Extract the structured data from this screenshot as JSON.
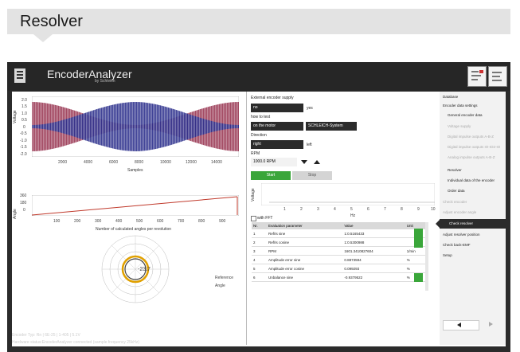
{
  "heading": {
    "title": "Resolver"
  },
  "app": {
    "title": "EncoderAnalyzer",
    "subtitle": "by Schleich",
    "toolbar_icons": [
      "report-icon",
      "export-icon"
    ]
  },
  "signal_chart": {
    "ylabel": "Voltage",
    "xlabel": "Samples",
    "y_ticks": [
      "2.0",
      "1.5",
      "1.0",
      "0.5",
      "0",
      "-0.5",
      "-1.0",
      "-1.5",
      "-2.0"
    ],
    "x_ticks": [
      "2000",
      "4000",
      "6000",
      "8000",
      "10000",
      "12000",
      "14000"
    ]
  },
  "angle_chart": {
    "ylabel": "Angle",
    "xlabel": "Number of calculated angles per revolution",
    "y_ticks": [
      "360",
      "180",
      "0"
    ],
    "x_ticks": [
      "100",
      "200",
      "300",
      "400",
      "500",
      "600",
      "700",
      "800",
      "900"
    ]
  },
  "polar": {
    "value": "-23.7",
    "legend": [
      "Reference",
      "Angle"
    ],
    "colors": [
      "#8a8a8a",
      "#e0a000"
    ]
  },
  "settings": {
    "supply_label": "External encoder supply",
    "supply_value": "no",
    "supply_unit": "yes",
    "test_label": "how to test",
    "test_value": "on the motor",
    "test_system": "SCHLEICH-System",
    "direction_label": "Direction",
    "direction_value": "right",
    "direction_alt": "left",
    "rpm_label": "RPM",
    "rpm_value": "1000.0 RPM",
    "start_label": "Start",
    "stop_label": "Stop"
  },
  "fft_chart": {
    "ylabel": "Voltage",
    "xlabel": "Hz",
    "x_ticks": [
      "1",
      "2",
      "3",
      "4",
      "5",
      "6",
      "7",
      "8",
      "9",
      "10"
    ],
    "checkbox_label": "with FFT"
  },
  "eval_table": {
    "headers": [
      "Nr.",
      "Evaluation parameter",
      "Value",
      "Unit"
    ],
    "rows": [
      [
        "1",
        "Ref/Is sine",
        "1:0.5165433",
        ""
      ],
      [
        "2",
        "Ref/Is cosine",
        "1:0.5300988",
        ""
      ],
      [
        "3",
        "RPM",
        "1601.3410827604",
        "1/min"
      ],
      [
        "4",
        "Amplitude error sine",
        "0.8873594",
        "%"
      ],
      [
        "5",
        "Amplitude error cosine",
        "0.099293",
        "%"
      ],
      [
        "6",
        "Unbalance sine",
        "-0.9379522",
        "%"
      ]
    ]
  },
  "nav": {
    "items": [
      {
        "label": "Database",
        "state": "collapsed",
        "level": 0
      },
      {
        "label": "Encoder data settings",
        "state": "expanded",
        "level": 0
      },
      {
        "label": "General encoder data",
        "state": "normal",
        "level": 1
      },
      {
        "label": "Voltage supply",
        "state": "disabled",
        "level": 1
      },
      {
        "label": "Digital impulse outputs A-B-Z",
        "state": "disabled",
        "level": 1
      },
      {
        "label": "Digital impulse outputs IO-IO2-IO",
        "state": "disabled",
        "level": 1
      },
      {
        "label": "Analog impulse outputs A-B-Z",
        "state": "disabled",
        "level": 1
      },
      {
        "label": "Resolver",
        "state": "normal",
        "level": 1
      },
      {
        "label": "Individual data of the encoder",
        "state": "normal",
        "level": 1
      },
      {
        "label": "Order data",
        "state": "normal",
        "level": 1
      },
      {
        "label": "Check encoder",
        "state": "disabled",
        "level": 0
      },
      {
        "label": "Adjust encoder angle",
        "state": "disabled",
        "level": 0
      },
      {
        "label": "Check resolver",
        "state": "active",
        "level": 0
      },
      {
        "label": "Adjust resolver position",
        "state": "collapsed",
        "level": 0
      },
      {
        "label": "Check back-EMF",
        "state": "collapsed",
        "level": 0
      },
      {
        "label": "Setup",
        "state": "collapsed",
        "level": 0
      }
    ]
  },
  "statusbar": {
    "line1": "Encoder Typ: Rn | 6E-25 | 1-405 | 5.1V",
    "line2": "Hardware status:EncoderAnalyzer connected (sample frequency 25kHz)"
  }
}
